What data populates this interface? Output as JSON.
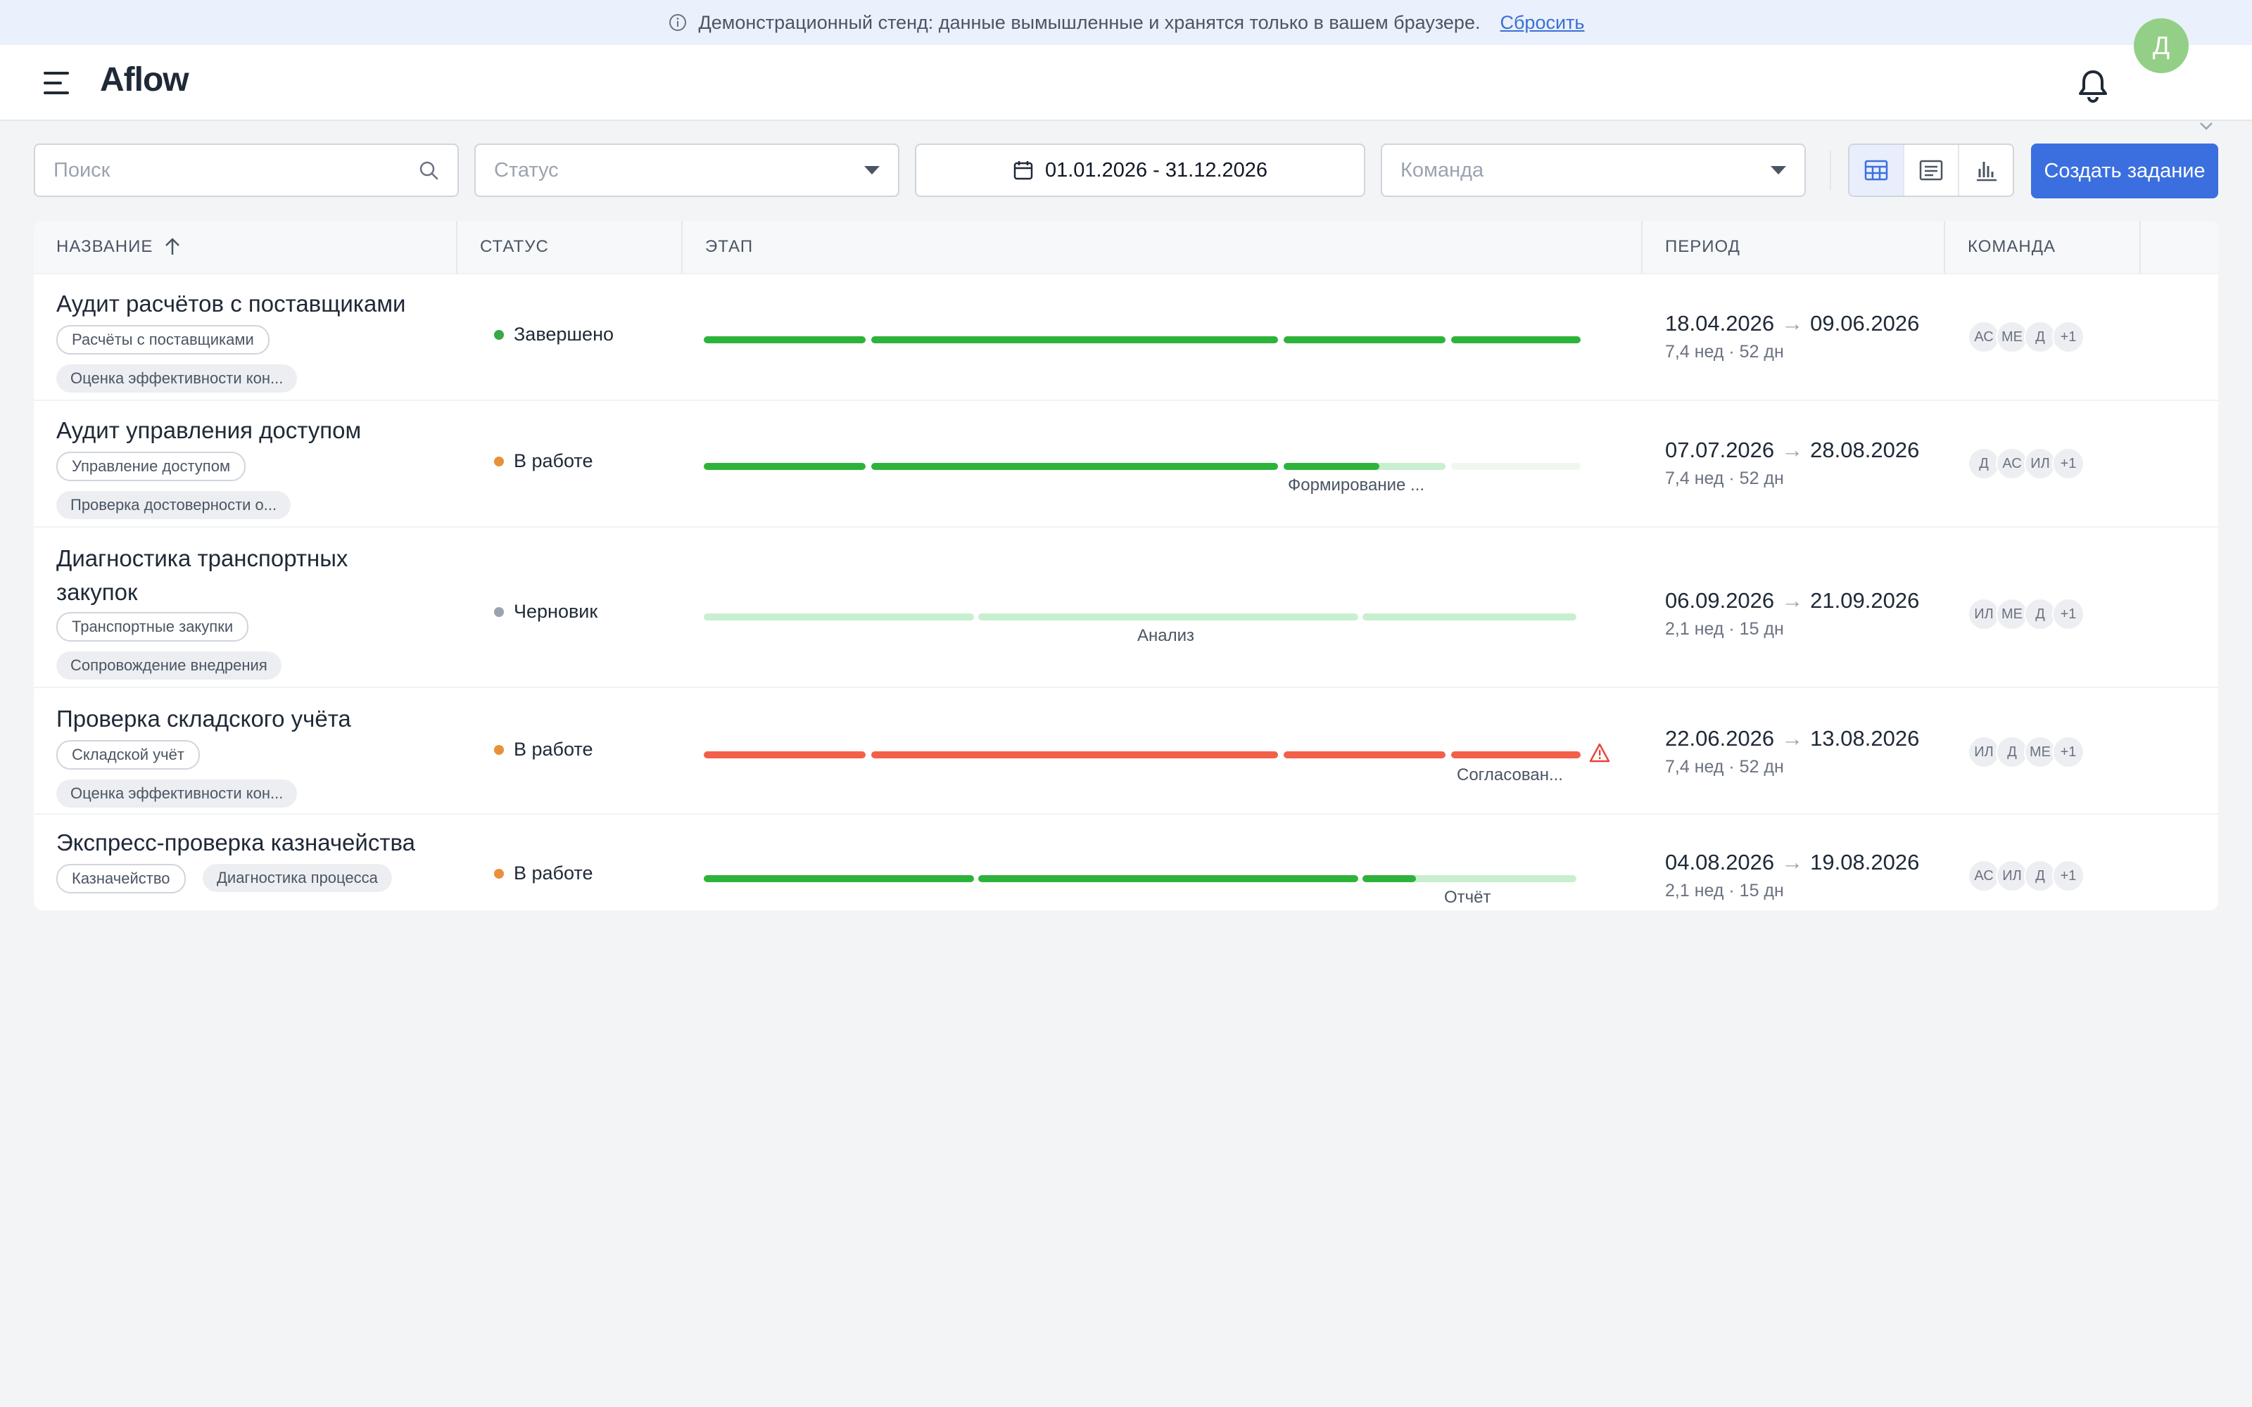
{
  "banner": {
    "text": "Демонстрационный стенд: данные вымышленные и хранятся только в вашем браузере.",
    "reset_label": "Сбросить"
  },
  "header": {
    "logo": "Aflow",
    "avatar_initial": "Д"
  },
  "toolbar": {
    "search_placeholder": "Поиск",
    "status_placeholder": "Статус",
    "date_range": "01.01.2026 - 31.12.2026",
    "team_placeholder": "Команда",
    "create_label": "Создать задание"
  },
  "table": {
    "columns": {
      "name": "НАЗВАНИЕ",
      "status": "СТАТУС",
      "stage": "ЭТАП",
      "period": "ПЕРИОД",
      "team": "КОМАНДА"
    },
    "rows": [
      {
        "title": "Аудит расчётов с поставщиками",
        "tags": [
          "Расчёты с поставщиками",
          "Оценка эффективности кон..."
        ],
        "status": "Завершено",
        "stage_label": "",
        "period": {
          "start": "18.04.2026",
          "end": "09.06.2026",
          "duration": "7,4 нед · 52 дн"
        },
        "team": [
          "АС",
          "МЕ",
          "Д",
          "+1"
        ]
      },
      {
        "title": "Аудит управления доступом",
        "tags": [
          "Управление доступом",
          "Проверка достоверности о..."
        ],
        "status": "В работе",
        "stage_label": "Формирование ...",
        "period": {
          "start": "07.07.2026",
          "end": "28.08.2026",
          "duration": "7,4 нед · 52 дн"
        },
        "team": [
          "Д",
          "АС",
          "ИЛ",
          "+1"
        ]
      },
      {
        "title": "Диагностика транспортных закупок",
        "tags": [
          "Транспортные закупки",
          "Сопровождение внедрения"
        ],
        "status": "Черновик",
        "stage_label": "Анализ",
        "period": {
          "start": "06.09.2026",
          "end": "21.09.2026",
          "duration": "2,1 нед · 15 дн"
        },
        "team": [
          "ИЛ",
          "МЕ",
          "Д",
          "+1"
        ]
      },
      {
        "title": "Проверка складского учёта",
        "tags": [
          "Складской учёт",
          "Оценка эффективности кон..."
        ],
        "status": "В работе",
        "stage_label": "Согласован...",
        "period": {
          "start": "22.06.2026",
          "end": "13.08.2026",
          "duration": "7,4 нед · 52 дн"
        },
        "team": [
          "ИЛ",
          "Д",
          "МЕ",
          "+1"
        ]
      },
      {
        "title": "Экспресс-проверка казначейства",
        "tags": [
          "Казначейство",
          "Диагностика процесса"
        ],
        "status": "В работе",
        "stage_label": "Отчёт",
        "period": {
          "start": "04.08.2026",
          "end": "19.08.2026",
          "duration": "2,1 нед · 15 дн"
        },
        "team": [
          "АС",
          "ИЛ",
          "Д",
          "+1"
        ]
      }
    ]
  },
  "colors": {
    "accent": "#3b6fe0",
    "status_done": "#3aa845",
    "status_in_progress": "#e9913a",
    "status_draft": "#9ca3af",
    "stage_green": "#2eb33a",
    "stage_light": "#c8efcf",
    "stage_faint": "#eef8f0",
    "stage_red": "#f2604a"
  }
}
